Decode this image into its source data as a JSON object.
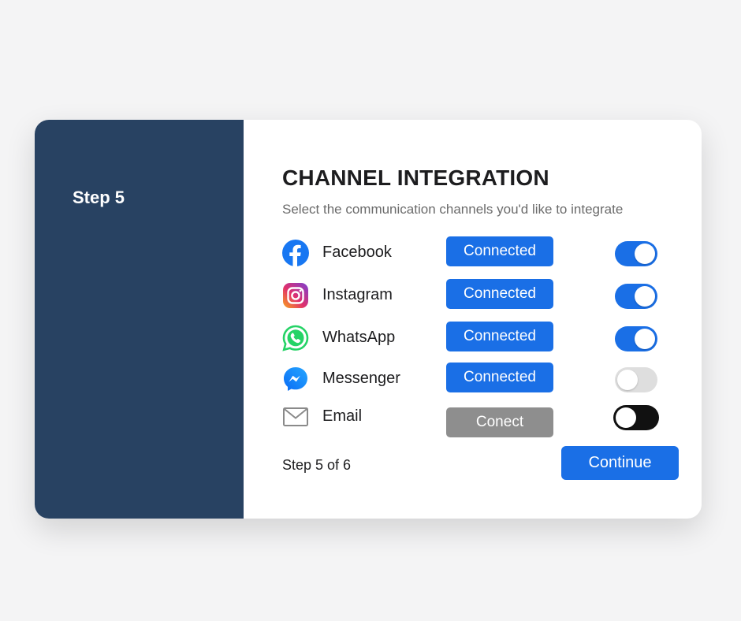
{
  "sidebar": {
    "step_label": "Step 5"
  },
  "header": {
    "title": "CHANNEL INTEGRATION",
    "subtitle": "Select the communication channels you'd like to integrate"
  },
  "channels": [
    {
      "name": "Facebook",
      "icon": "facebook-icon",
      "button": "Connected",
      "status": "connected",
      "toggle": "on"
    },
    {
      "name": "Instagram",
      "icon": "instagram-icon",
      "button": "Connected",
      "status": "connected",
      "toggle": "on"
    },
    {
      "name": "WhatsApp",
      "icon": "whatsapp-icon",
      "button": "Connected",
      "status": "connected",
      "toggle": "on"
    },
    {
      "name": "Messenger",
      "icon": "messenger-icon",
      "button": "Connected",
      "status": "connected",
      "toggle": "off"
    },
    {
      "name": "Email",
      "icon": "email-icon",
      "button": "Conect",
      "status": "not-connected",
      "toggle": "off"
    }
  ],
  "footer": {
    "progress": "Step 5 of 6",
    "continue_label": "Continue"
  },
  "colors": {
    "sidebar": "#284262",
    "accent": "#1a6fe6",
    "disabled_button": "#8e8e8e"
  }
}
